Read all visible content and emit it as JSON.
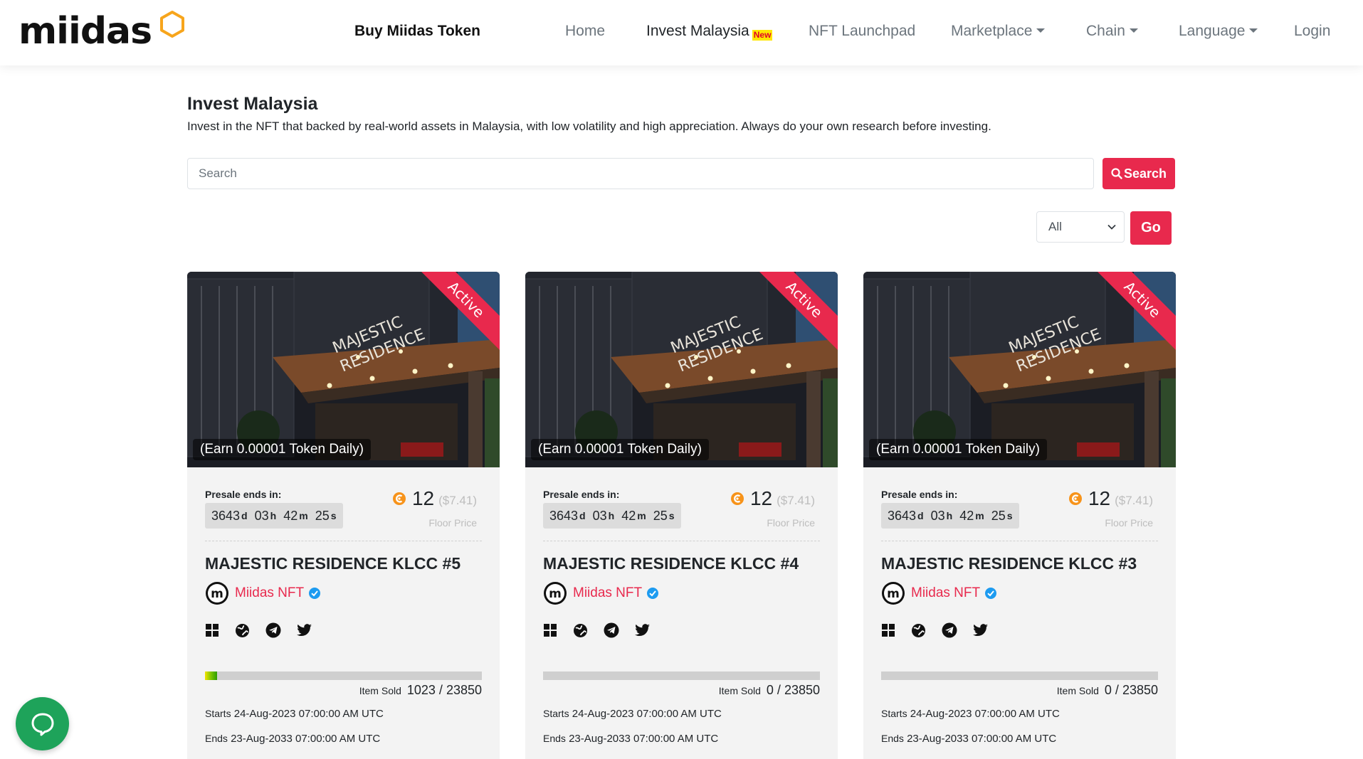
{
  "nav": {
    "logo_text": "miidas",
    "buy_token": "Buy Miidas Token",
    "items": [
      {
        "label": "Home"
      },
      {
        "label": "Invest Malaysia",
        "badge": "New"
      },
      {
        "label": "NFT Launchpad"
      },
      {
        "label": "Marketplace"
      },
      {
        "label": "Chain"
      },
      {
        "label": "Language"
      },
      {
        "label": "Login"
      }
    ]
  },
  "page": {
    "title": "Invest Malaysia",
    "description": "Invest in the NFT that backed by real-world assets in Malaysia, with low volatility and high appreciation. Always do your own research before investing."
  },
  "search": {
    "placeholder": "Search",
    "button_label": "Search"
  },
  "filter": {
    "selected": "All",
    "go_label": "Go"
  },
  "cards": [
    {
      "image_text": "MAJESTIC RESIDENCE",
      "ribbon": "Active",
      "earn": "(Earn 0.00001 Token Daily)",
      "presale_label": "Presale ends in:",
      "countdown": {
        "d": "3643",
        "h": "03",
        "m": "42",
        "s": "25"
      },
      "units": {
        "d": "d",
        "h": "h",
        "m": "m",
        "s": "s"
      },
      "price": "12",
      "price_usd": "($7.41)",
      "floor_label": "Floor Price",
      "title": "MAJESTIC RESIDENCE KLCC #5",
      "creator": "Miidas NFT",
      "item_sold_label": "Item Sold",
      "sold": "1023",
      "total": "23850",
      "sold_fraction": 0.0429,
      "starts_label": "Starts",
      "starts": "24-Aug-2023 07:00:00 AM UTC",
      "ends_label": "Ends",
      "ends": "23-Aug-2033 07:00:00 AM UTC"
    },
    {
      "image_text": "MAJESTIC RESIDENCE",
      "ribbon": "Active",
      "earn": "(Earn 0.00001 Token Daily)",
      "presale_label": "Presale ends in:",
      "countdown": {
        "d": "3643",
        "h": "03",
        "m": "42",
        "s": "25"
      },
      "units": {
        "d": "d",
        "h": "h",
        "m": "m",
        "s": "s"
      },
      "price": "12",
      "price_usd": "($7.41)",
      "floor_label": "Floor Price",
      "title": "MAJESTIC RESIDENCE KLCC #4",
      "creator": "Miidas NFT",
      "item_sold_label": "Item Sold",
      "sold": "0",
      "total": "23850",
      "sold_fraction": 0,
      "starts_label": "Starts",
      "starts": "24-Aug-2023 07:00:00 AM UTC",
      "ends_label": "Ends",
      "ends": "23-Aug-2033 07:00:00 AM UTC"
    },
    {
      "image_text": "MAJESTIC RESIDENCE",
      "ribbon": "Active",
      "earn": "(Earn 0.00001 Token Daily)",
      "presale_label": "Presale ends in:",
      "countdown": {
        "d": "3643",
        "h": "03",
        "m": "42",
        "s": "25"
      },
      "units": {
        "d": "d",
        "h": "h",
        "m": "m",
        "s": "s"
      },
      "price": "12",
      "price_usd": "($7.41)",
      "floor_label": "Floor Price",
      "title": "MAJESTIC RESIDENCE KLCC #3",
      "creator": "Miidas NFT",
      "item_sold_label": "Item Sold",
      "sold": "0",
      "total": "23850",
      "sold_fraction": 0,
      "starts_label": "Starts",
      "starts": "24-Aug-2023 07:00:00 AM UTC",
      "ends_label": "Ends",
      "ends": "23-Aug-2033 07:00:00 AM UTC"
    }
  ],
  "colors": {
    "accent": "#e8294d",
    "logo_hex": "#f7a51c",
    "verified": "#1d9bf0",
    "chat": "#1ea35a"
  },
  "icons": {
    "logo": "hexagon-icon",
    "search": "search-icon",
    "token": "token-coin-icon",
    "creator": "miidas-m-icon",
    "verified": "verified-check-icon",
    "socials": [
      "grid-icon",
      "globe-icon",
      "telegram-icon",
      "twitter-icon"
    ],
    "chat": "chat-bubble-icon"
  }
}
